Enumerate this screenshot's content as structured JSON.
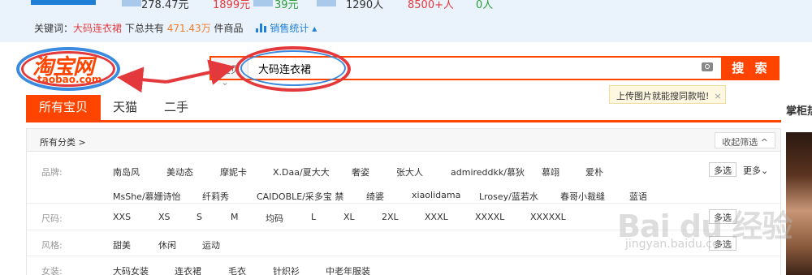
{
  "stats": {
    "values": [
      "278.47元",
      "1899元",
      "39元",
      "1290人",
      "8500+人",
      "0人"
    ],
    "colors": [
      "#333333",
      "#e4393c",
      "#2a9d3a",
      "#333333",
      "#e4393c",
      "#2a9d3a"
    ]
  },
  "keyword_line": {
    "prefix": "关键词：",
    "keyword": "大码连衣裙",
    "middle": "下总共有",
    "count": "471.43万",
    "suffix": "件商品",
    "sales_link": "销售统计"
  },
  "logo": {
    "name": "淘宝网",
    "domain": "taobao.com"
  },
  "search": {
    "scope": "宝贝",
    "query": "大码连衣裙",
    "button": "搜 索",
    "tooltip": "上传图片就能搜同款啦!",
    "tooltip_close": "×"
  },
  "tabs": [
    "所有宝贝",
    "天猫",
    "二手"
  ],
  "sidebar_title": "掌柜热卖",
  "filters": {
    "breadcrumb": "所有分类 >",
    "collapse": "收起筛选 ^",
    "multi_select": "多选",
    "more": "更多",
    "rows": [
      {
        "label": "品牌:",
        "line1": [
          "南岛风",
          "美动态",
          "摩妮卡",
          "X.Daa/夏大大",
          "奢姿",
          "张大人",
          "admireddkk/慕狄",
          "慕翊",
          "爱朴"
        ],
        "line2": [
          "MsShe/慕姗诗怡",
          "纤莉秀",
          "CAIDOBLE/采多宝 禁",
          "绮婆",
          "xiaolidama",
          "Lrosey/蓝若水",
          "春哥小裁缝",
          "蓝语"
        ]
      },
      {
        "label": "尺码:",
        "options": [
          "XXS",
          "XS",
          "S",
          "M",
          "均码",
          "L",
          "XL",
          "2XL",
          "XXXL",
          "XXXXL",
          "XXXXXL"
        ]
      },
      {
        "label": "风格:",
        "options": [
          "甜美",
          "休闲",
          "运动"
        ]
      },
      {
        "label": "女装:",
        "options": [
          "大码女装",
          "连衣裙",
          "毛衣",
          "针织衫",
          "中老年服装"
        ]
      }
    ]
  },
  "watermark": {
    "main": "Bai du 经验",
    "sub": "jingyan.baidu.com"
  },
  "colors": {
    "brand_orange": "#ff4400",
    "annotation_red": "#e4393c",
    "annotation_blue": "#3a8ae0"
  }
}
